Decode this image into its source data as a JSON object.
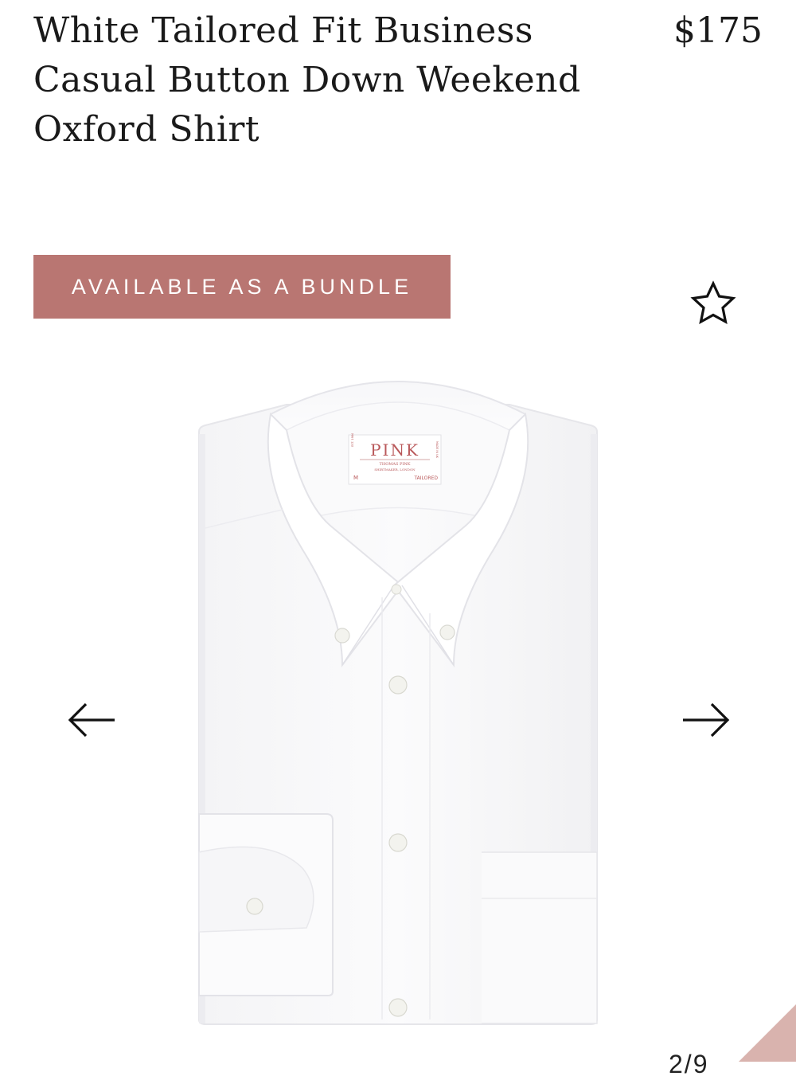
{
  "product": {
    "title": "White Tailored Fit Business Casual Button Down Weekend Oxford Shirt",
    "price": "$175"
  },
  "badge": {
    "label": "AVAILABLE AS A BUNDLE",
    "color": "#b97672"
  },
  "actions": {
    "favorite_icon": "star-outline-icon",
    "prev_icon": "arrow-left-icon",
    "next_icon": "arrow-right-icon"
  },
  "image": {
    "label": {
      "brand": "PINK",
      "maker_line1": "THOMAS PINK",
      "maker_line2": "SHIRTMAKER, LONDON",
      "size": "M",
      "fit": "TAILORED",
      "side_left": "EST. 1984",
      "side_right": "MADE IN UK"
    },
    "color": "#ffffff"
  },
  "carousel": {
    "counter": "2/9"
  },
  "accent_color": "#d9b3ae"
}
